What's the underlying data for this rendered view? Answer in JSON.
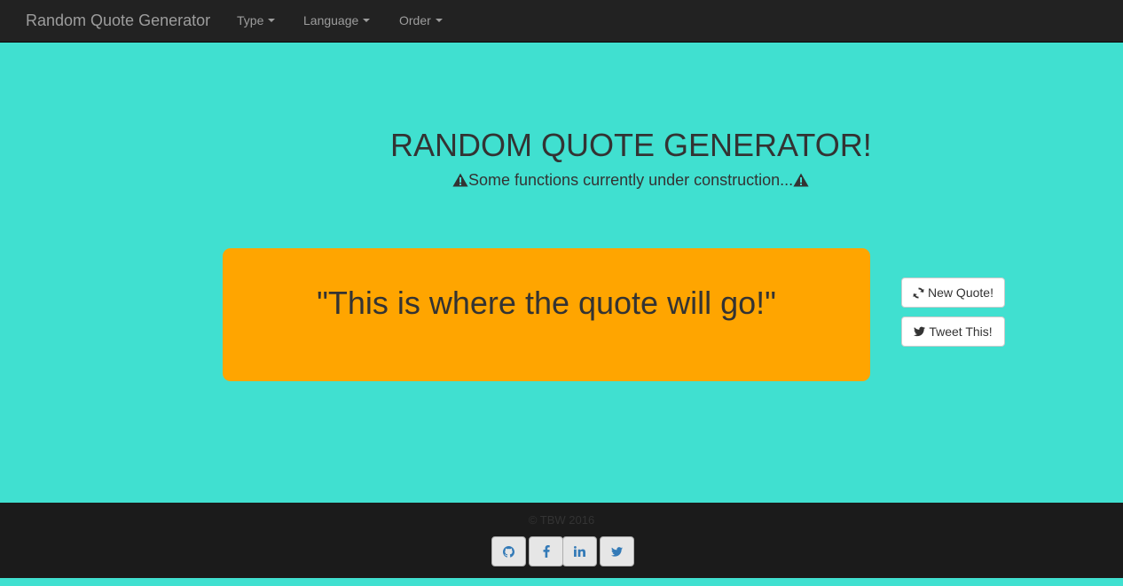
{
  "navbar": {
    "brand": "Random Quote Generator",
    "menu": [
      {
        "label": "Type"
      },
      {
        "label": "Language"
      },
      {
        "label": "Order"
      }
    ]
  },
  "hero": {
    "title": "RANDOM QUOTE GENERATOR!",
    "subtitle": "Some functions currently under construction..."
  },
  "quote": {
    "text": "\"This is where the quote will go!\""
  },
  "actions": {
    "new_quote": "New Quote!",
    "tweet": "Tweet This!"
  },
  "footer": {
    "copyright": "© TBW 2016",
    "social": [
      {
        "icon": "github-icon"
      },
      {
        "icon": "facebook-icon"
      },
      {
        "icon": "linkedin-icon"
      },
      {
        "icon": "twitter-icon"
      }
    ]
  },
  "colors": {
    "background": "#40E0D0",
    "navbar": "#222222",
    "quote_box": "#FFA500",
    "footer": "#1B1B1B",
    "social_icon": "#337AB7"
  }
}
